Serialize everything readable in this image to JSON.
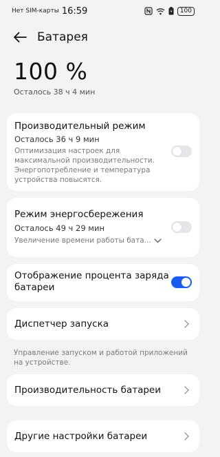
{
  "status_bar": {
    "carrier": "Нет SIM-карты",
    "time": "16:59",
    "battery_level": "100",
    "icons": [
      "nfc-icon",
      "wifi-icon",
      "battery-saver-icon",
      "battery-icon"
    ]
  },
  "header": {
    "title": "Батарея",
    "back_icon": "arrow-left-icon"
  },
  "battery": {
    "percent": "100 %",
    "remaining": "Осталось 38 ч 4 мин"
  },
  "performance_mode": {
    "title": "Производительный режим",
    "remaining": "Осталось 36 ч 9 мин",
    "description": "Оптимизация настроек для максимальной производительности. Энергопотребление и температура устройства повысятся.",
    "enabled": false
  },
  "power_saving": {
    "title": "Режим энергосбережения",
    "remaining": "Осталось 49 ч 29 мин",
    "description": "Увеличение времени работы бата...",
    "enabled": false
  },
  "show_percentage": {
    "title": "Отображение процента заряда батареи",
    "enabled": true
  },
  "launch_manager": {
    "title": "Диспетчер запуска",
    "hint": "Управление запуском и работой приложений на устройстве."
  },
  "battery_performance": {
    "title": "Производительность батареи"
  },
  "other_settings": {
    "title": "Другие настройки батареи"
  },
  "colors": {
    "accent": "#1a5cf0",
    "background": "#f1f3f5",
    "card": "#ffffff"
  }
}
